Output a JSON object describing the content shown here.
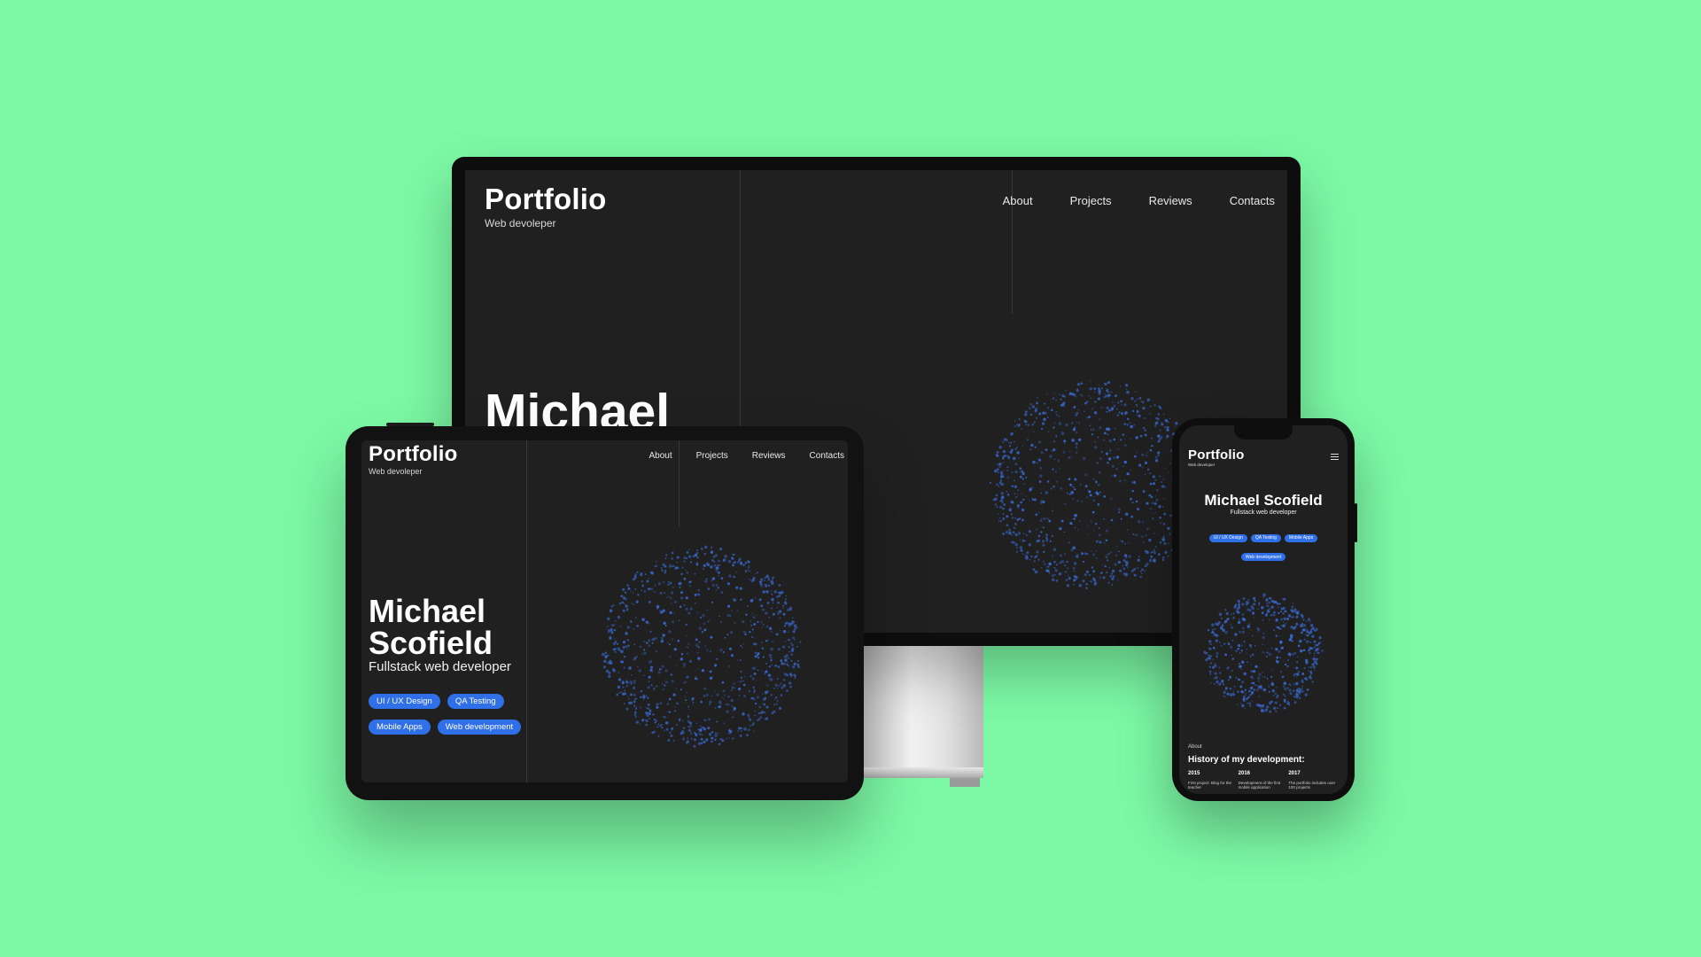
{
  "site": {
    "brand_title": "Portfolio",
    "brand_subtitle": "Web devoleper",
    "nav": [
      "About",
      "Projects",
      "Reviews",
      "Contacts"
    ],
    "name_first": "Michael",
    "name_last": "Scofield",
    "role": "Fullstack web developer",
    "tags": [
      "UI / UX Design",
      "QA Testing",
      "Mobile Apps",
      "Web development"
    ]
  },
  "desktop": {
    "brand_title": "Portfolio",
    "brand_subtitle": "Web devoleper",
    "hero_name_partial": "Michael"
  },
  "tablet": {
    "brand_title": "Portfolio",
    "brand_subtitle": "Web devoleper"
  },
  "phone": {
    "brand_title": "Portfolio",
    "brand_subtitle": "Web developer",
    "name": "Michael Scofield",
    "role": "Fullstack web developer",
    "about_label": "About",
    "about_title": "History of my development:",
    "history": [
      {
        "year": "2015",
        "text": "First project: Blog for the teacher"
      },
      {
        "year": "2016",
        "text": "Development of the first mobile application"
      },
      {
        "year": "2017",
        "text": "The portfolio includes over 100 projects"
      }
    ]
  },
  "colors": {
    "background": "#7cf9a5",
    "screen": "#202020",
    "accent": "#2f6fe8",
    "particles": "#3b6fe0"
  }
}
